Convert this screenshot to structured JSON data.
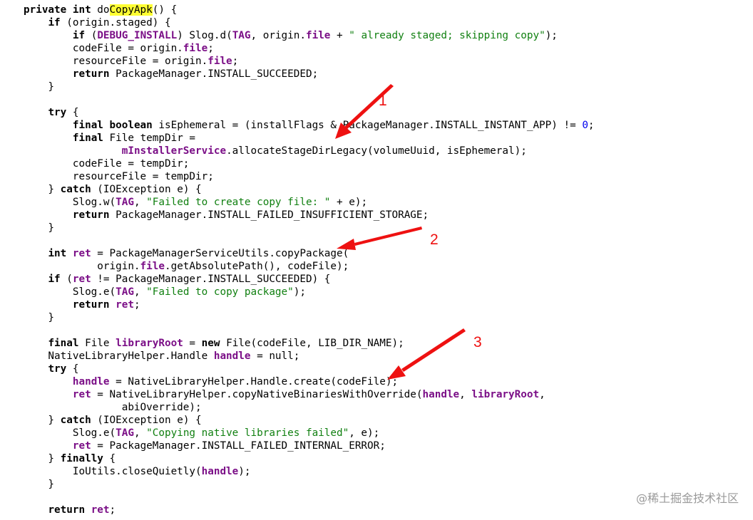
{
  "code": {
    "lines": [
      [
        {
          "t": "private int ",
          "c": "k"
        },
        {
          "t": "do"
        },
        {
          "t": "CopyApk",
          "c": "hl"
        },
        {
          "t": "() {"
        }
      ],
      [
        {
          "t": "    "
        },
        {
          "t": "if",
          "c": "k"
        },
        {
          "t": " (origin.staged) {"
        }
      ],
      [
        {
          "t": "        "
        },
        {
          "t": "if",
          "c": "k"
        },
        {
          "t": " ("
        },
        {
          "t": "DEBUG_INSTALL",
          "c": "f"
        },
        {
          "t": ") Slog.d("
        },
        {
          "t": "TAG",
          "c": "f"
        },
        {
          "t": ", origin."
        },
        {
          "t": "file",
          "c": "f"
        },
        {
          "t": " + "
        },
        {
          "t": "\" already staged; skipping copy\"",
          "c": "s"
        },
        {
          "t": ");"
        }
      ],
      [
        {
          "t": "        codeFile = origin."
        },
        {
          "t": "file",
          "c": "f"
        },
        {
          "t": ";"
        }
      ],
      [
        {
          "t": "        resourceFile = origin."
        },
        {
          "t": "file",
          "c": "f"
        },
        {
          "t": ";"
        }
      ],
      [
        {
          "t": "        "
        },
        {
          "t": "return",
          "c": "k"
        },
        {
          "t": " PackageManager.INSTALL_SUCCEEDED;"
        }
      ],
      [
        {
          "t": "    }"
        }
      ],
      [
        {
          "t": ""
        }
      ],
      [
        {
          "t": "    "
        },
        {
          "t": "try",
          "c": "k"
        },
        {
          "t": " {"
        }
      ],
      [
        {
          "t": "        "
        },
        {
          "t": "final boolean",
          "c": "k"
        },
        {
          "t": " isEphemeral = (installFlags & PackageManager.INSTALL_INSTANT_APP) != "
        },
        {
          "t": "0",
          "c": "n"
        },
        {
          "t": ";"
        }
      ],
      [
        {
          "t": "        "
        },
        {
          "t": "final",
          "c": "k"
        },
        {
          "t": " File tempDir ="
        }
      ],
      [
        {
          "t": "                "
        },
        {
          "t": "mInstallerService",
          "c": "f"
        },
        {
          "t": ".allocateStageDirLegacy(volumeUuid, isEphemeral);"
        }
      ],
      [
        {
          "t": "        codeFile = tempDir;"
        }
      ],
      [
        {
          "t": "        resourceFile = tempDir;"
        }
      ],
      [
        {
          "t": "    } "
        },
        {
          "t": "catch",
          "c": "k"
        },
        {
          "t": " (IOException e) {"
        }
      ],
      [
        {
          "t": "        Slog.w("
        },
        {
          "t": "TAG",
          "c": "f"
        },
        {
          "t": ", "
        },
        {
          "t": "\"Failed to create copy file: \"",
          "c": "s"
        },
        {
          "t": " + e);"
        }
      ],
      [
        {
          "t": "        "
        },
        {
          "t": "return",
          "c": "k"
        },
        {
          "t": " PackageManager.INSTALL_FAILED_INSUFFICIENT_STORAGE;"
        }
      ],
      [
        {
          "t": "    }"
        }
      ],
      [
        {
          "t": ""
        }
      ],
      [
        {
          "t": "    "
        },
        {
          "t": "int",
          "c": "k"
        },
        {
          "t": " "
        },
        {
          "t": "ret",
          "c": "f"
        },
        {
          "t": " = PackageManagerServiceUtils.copyPackage("
        }
      ],
      [
        {
          "t": "            origin."
        },
        {
          "t": "file",
          "c": "f"
        },
        {
          "t": ".getAbsolutePath(), codeFile);"
        }
      ],
      [
        {
          "t": "    "
        },
        {
          "t": "if",
          "c": "k"
        },
        {
          "t": " ("
        },
        {
          "t": "ret",
          "c": "f"
        },
        {
          "t": " != PackageManager.INSTALL_SUCCEEDED) {"
        }
      ],
      [
        {
          "t": "        Slog.e("
        },
        {
          "t": "TAG",
          "c": "f"
        },
        {
          "t": ", "
        },
        {
          "t": "\"Failed to copy package\"",
          "c": "s"
        },
        {
          "t": ");"
        }
      ],
      [
        {
          "t": "        "
        },
        {
          "t": "return",
          "c": "k"
        },
        {
          "t": " "
        },
        {
          "t": "ret",
          "c": "f"
        },
        {
          "t": ";"
        }
      ],
      [
        {
          "t": "    }"
        }
      ],
      [
        {
          "t": ""
        }
      ],
      [
        {
          "t": "    "
        },
        {
          "t": "final",
          "c": "k"
        },
        {
          "t": " File "
        },
        {
          "t": "libraryRoot",
          "c": "f"
        },
        {
          "t": " = "
        },
        {
          "t": "new",
          "c": "k"
        },
        {
          "t": " File(codeFile, LIB_DIR_NAME);"
        }
      ],
      [
        {
          "t": "    NativeLibraryHelper.Handle "
        },
        {
          "t": "handle",
          "c": "f"
        },
        {
          "t": " = null;"
        }
      ],
      [
        {
          "t": "    "
        },
        {
          "t": "try",
          "c": "k"
        },
        {
          "t": " {"
        }
      ],
      [
        {
          "t": "        "
        },
        {
          "t": "handle",
          "c": "f"
        },
        {
          "t": " = NativeLibraryHelper.Handle.create(codeFile);"
        }
      ],
      [
        {
          "t": "        "
        },
        {
          "t": "ret",
          "c": "f"
        },
        {
          "t": " = NativeLibraryHelper.copyNativeBinariesWithOverride("
        },
        {
          "t": "handle",
          "c": "f"
        },
        {
          "t": ", "
        },
        {
          "t": "libraryRoot",
          "c": "f"
        },
        {
          "t": ","
        }
      ],
      [
        {
          "t": "                abiOverride);"
        }
      ],
      [
        {
          "t": "    } "
        },
        {
          "t": "catch",
          "c": "k"
        },
        {
          "t": " (IOException e) {"
        }
      ],
      [
        {
          "t": "        Slog.e("
        },
        {
          "t": "TAG",
          "c": "f"
        },
        {
          "t": ", "
        },
        {
          "t": "\"Copying native libraries failed\"",
          "c": "s"
        },
        {
          "t": ", e);"
        }
      ],
      [
        {
          "t": "        "
        },
        {
          "t": "ret",
          "c": "f"
        },
        {
          "t": " = PackageManager.INSTALL_FAILED_INTERNAL_ERROR;"
        }
      ],
      [
        {
          "t": "    } "
        },
        {
          "t": "finally",
          "c": "k"
        },
        {
          "t": " {"
        }
      ],
      [
        {
          "t": "        IoUtils.closeQuietly("
        },
        {
          "t": "handle",
          "c": "f"
        },
        {
          "t": ");"
        }
      ],
      [
        {
          "t": "    }"
        }
      ],
      [
        {
          "t": ""
        }
      ],
      [
        {
          "t": "    "
        },
        {
          "t": "return",
          "c": "k"
        },
        {
          "t": " "
        },
        {
          "t": "ret",
          "c": "f"
        },
        {
          "t": ";"
        }
      ]
    ]
  },
  "annotations": {
    "label_1": "1",
    "label_2": "2",
    "label_3": "3",
    "color": "#ee1111"
  },
  "watermark": "@稀土掘金技术社区"
}
